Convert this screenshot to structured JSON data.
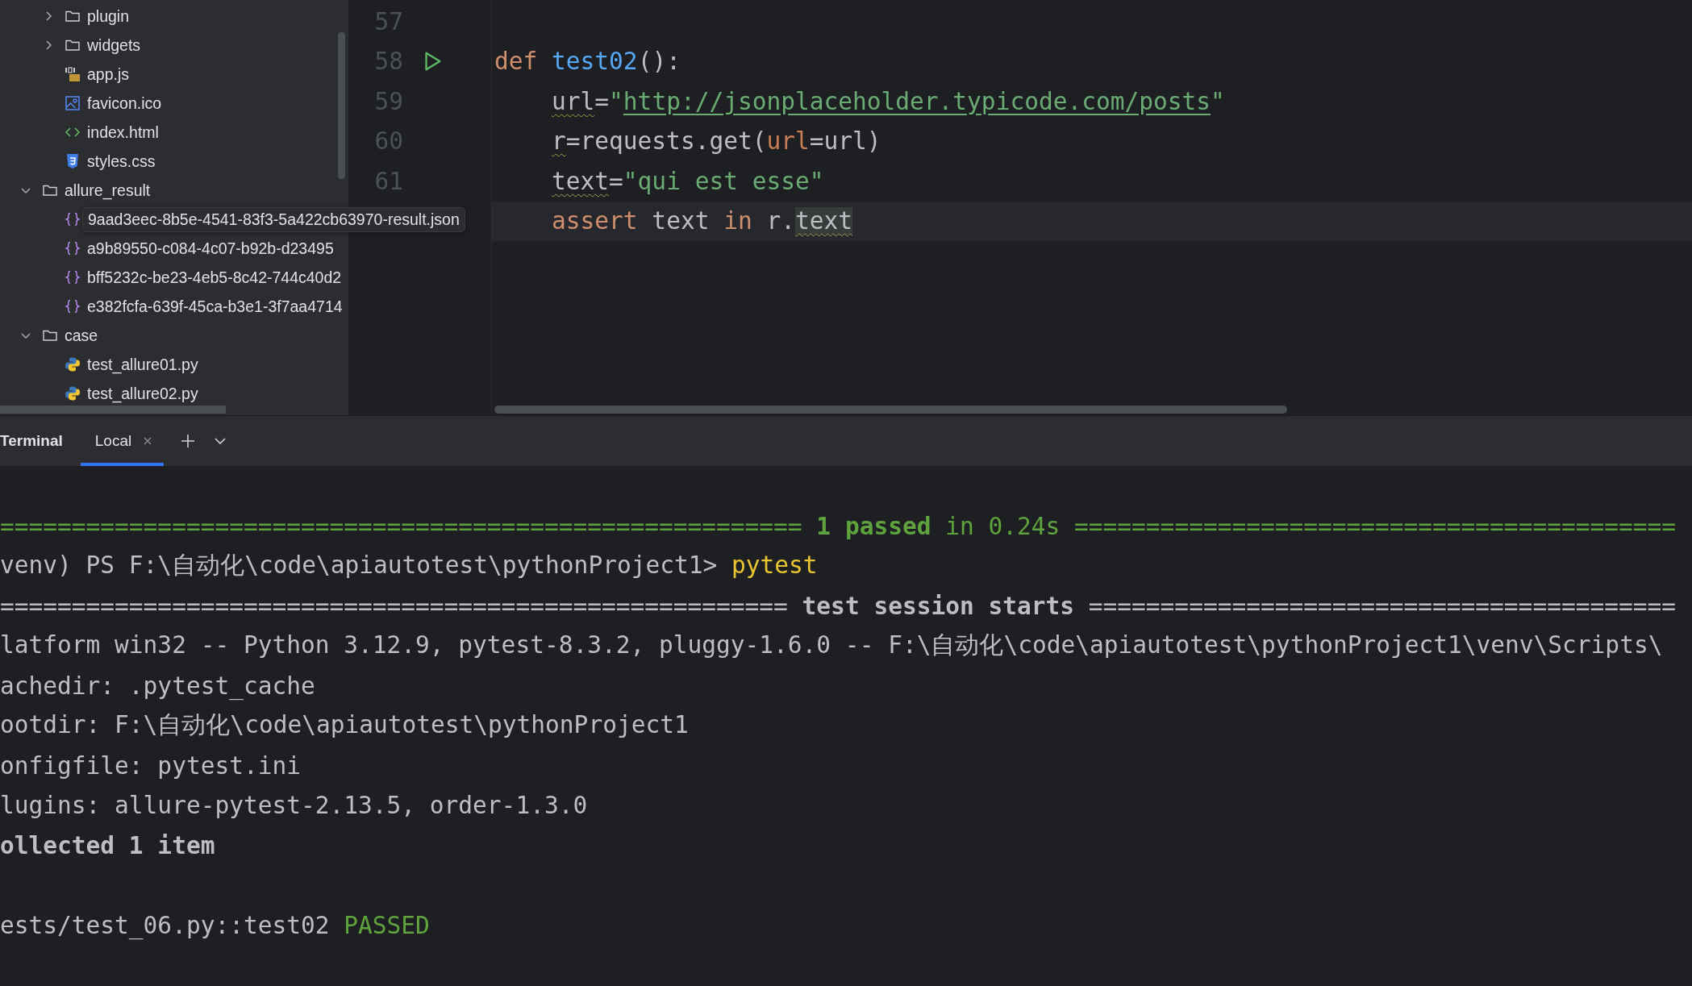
{
  "project_tree": [
    {
      "children": [
        {
          "name": "plugin",
          "kind": "folder",
          "expanded": false
        },
        {
          "name": "widgets",
          "kind": "folder",
          "expanded": false
        },
        {
          "name": "app.js",
          "kind": "js"
        },
        {
          "name": "favicon.ico",
          "kind": "image"
        },
        {
          "name": "index.html",
          "kind": "html"
        },
        {
          "name": "styles.css",
          "kind": "css"
        }
      ]
    },
    {
      "name": "allure_result",
      "kind": "folder",
      "expanded": true,
      "children": [
        {
          "name": "9aad3eec-8b5e-4541-83f3-5a422cb63970-result.json",
          "kind": "json",
          "hovered": true
        },
        {
          "name": "a9b89550-c084-4c07-b92b-d23495",
          "kind": "json"
        },
        {
          "name": "bff5232c-be23-4eb5-8c42-744c40d2",
          "kind": "json"
        },
        {
          "name": "e382fcfa-639f-45ca-b3e1-3f7aa4714",
          "kind": "json"
        }
      ]
    },
    {
      "name": "case",
      "kind": "folder",
      "expanded": true,
      "children": [
        {
          "name": "test_allure01.py",
          "kind": "python"
        },
        {
          "name": "test_allure02.py",
          "kind": "python"
        }
      ]
    }
  ],
  "editor": {
    "lines": [
      {
        "number": "57"
      },
      {
        "number": "58",
        "run_marker": true,
        "tokens": [
          {
            "text": "def ",
            "kind": "keyword"
          },
          {
            "text": "test02",
            "kind": "function"
          },
          {
            "text": "():",
            "kind": "plain"
          }
        ]
      },
      {
        "number": "59",
        "indent": true,
        "tokens": [
          {
            "text": "url",
            "kind": "plain",
            "warn": true
          },
          {
            "text": "=",
            "kind": "plain"
          },
          {
            "text": "\"",
            "kind": "string"
          },
          {
            "text": "http://jsonplaceholder.typicode.com/posts",
            "kind": "link"
          },
          {
            "text": "\"",
            "kind": "string"
          }
        ]
      },
      {
        "number": "60",
        "indent": true,
        "tokens": [
          {
            "text": "r",
            "kind": "plain",
            "warn": true
          },
          {
            "text": "=requests.get(",
            "kind": "plain"
          },
          {
            "text": "url",
            "kind": "param"
          },
          {
            "text": "=url)",
            "kind": "plain"
          }
        ]
      },
      {
        "number": "61",
        "indent": true,
        "tokens": [
          {
            "text": "text",
            "kind": "plain",
            "warn": true
          },
          {
            "text": "=",
            "kind": "plain"
          },
          {
            "text": "\"qui est esse\"",
            "kind": "string"
          }
        ]
      },
      {
        "current": true,
        "indent": true,
        "tokens": [
          {
            "text": "assert",
            "kind": "keyword"
          },
          {
            "text": " text ",
            "kind": "plain"
          },
          {
            "text": "in",
            "kind": "keyword"
          },
          {
            "text": " r.",
            "kind": "plain"
          },
          {
            "text": "text",
            "kind": "usage",
            "warn": true
          }
        ]
      }
    ]
  },
  "terminal": {
    "title": "Terminal",
    "tabs": [
      {
        "label": "Local",
        "selected": true
      }
    ],
    "lines": [
      {
        "segments": [
          {
            "text": "======================================================== ",
            "kind": "pass"
          },
          {
            "text": "1 passed",
            "kind": "pass_bold"
          },
          {
            "text": " in 0.24s ==========================================",
            "kind": "pass"
          }
        ]
      },
      {
        "segments": [
          {
            "text": "venv) PS F:\\自动化\\code\\apiautotest\\pythonProject1> ",
            "kind": "plain"
          },
          {
            "text": "pytest",
            "kind": "command"
          }
        ]
      },
      {
        "segments": [
          {
            "text": "======================================================= ",
            "kind": "plain"
          },
          {
            "text": "test session starts",
            "kind": "bold"
          },
          {
            "text": " =========================================",
            "kind": "plain"
          }
        ]
      },
      {
        "segments": [
          {
            "text": "latform win32 -- Python 3.12.9, pytest-8.3.2, pluggy-1.6.0 -- F:\\自动化\\code\\apiautotest\\pythonProject1\\venv\\Scripts\\",
            "kind": "plain"
          }
        ]
      },
      {
        "segments": [
          {
            "text": "achedir: .pytest_cache",
            "kind": "plain"
          }
        ]
      },
      {
        "segments": [
          {
            "text": "ootdir: F:\\自动化\\code\\apiautotest\\pythonProject1",
            "kind": "plain"
          }
        ]
      },
      {
        "segments": [
          {
            "text": "onfigfile: pytest.ini",
            "kind": "plain"
          }
        ]
      },
      {
        "segments": [
          {
            "text": "lugins: allure-pytest-2.13.5, order-1.3.0",
            "kind": "plain"
          }
        ]
      },
      {
        "segments": [
          {
            "text": "ollected 1 item",
            "kind": "bold"
          }
        ]
      },
      {
        "spaced": true,
        "segments": [
          {
            "text": "ests/test_06.py::test02 ",
            "kind": "plain"
          },
          {
            "text": "PASSED",
            "kind": "pass"
          }
        ]
      }
    ]
  }
}
